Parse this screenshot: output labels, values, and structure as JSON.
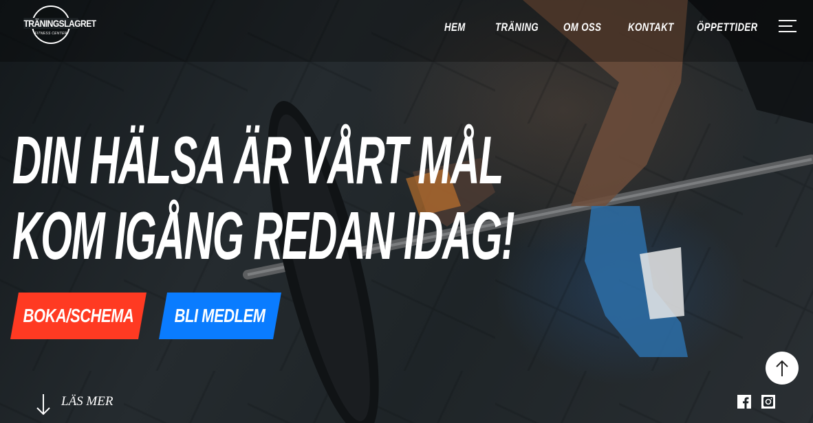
{
  "brand": {
    "name": "TRÄNINGSLAGRET",
    "tagline": "FITNESS CENTER"
  },
  "nav": {
    "items": [
      "HEM",
      "TRÄNING",
      "OM OSS",
      "KONTAKT",
      "ÖPPETTIDER"
    ]
  },
  "hero": {
    "line1": "DIN HÄLSA ÄR VÅRT MÅL",
    "line2": "KOM IGÅNG REDAN IDAG!",
    "primary_button": "BOKA/SCHEMA",
    "secondary_button": "BLI MEDLEM",
    "read_more": "LÄS MER"
  },
  "icons": {
    "menu": "hamburger-menu-icon",
    "read_more": "arrow-down-icon",
    "scroll_top": "arrow-up-icon",
    "social": [
      "facebook-icon",
      "instagram-icon"
    ]
  },
  "colors": {
    "primary_button": "#ff3a22",
    "secondary_button": "#0a7cff",
    "text": "#ffffff"
  }
}
